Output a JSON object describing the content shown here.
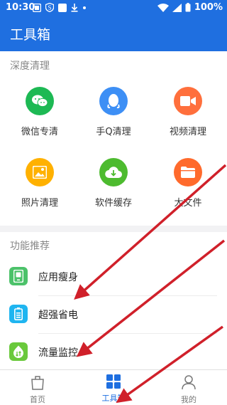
{
  "statusbar": {
    "time": "10:30",
    "battery": "100%"
  },
  "appbar": {
    "title": "工具箱"
  },
  "deep_clean": {
    "title": "深度清理",
    "items": [
      {
        "label": "微信专清",
        "icon": "wechat-icon",
        "color": "#1db954"
      },
      {
        "label": "手Q清理",
        "icon": "qq-penguin-icon",
        "color": "#3d8ff5"
      },
      {
        "label": "视频清理",
        "icon": "video-camera-icon",
        "color": "#ff6f3c"
      },
      {
        "label": "照片清理",
        "icon": "photo-icon",
        "color": "#ffb100"
      },
      {
        "label": "软件缓存",
        "icon": "cloud-download-icon",
        "color": "#4dbb2f"
      },
      {
        "label": "大文件",
        "icon": "folder-icon",
        "color": "#ff6a2c"
      }
    ]
  },
  "recommend": {
    "title": "功能推荐",
    "items": [
      {
        "label": "应用瘦身",
        "icon": "app-slim-icon",
        "color": "#4cc26a"
      },
      {
        "label": "超强省电",
        "icon": "battery-icon",
        "color": "#1fb5f0"
      },
      {
        "label": "流量监控",
        "icon": "traffic-monitor-icon",
        "color": "#6ac93c"
      }
    ]
  },
  "tabbar": {
    "tabs": [
      {
        "label": "首页",
        "active": false
      },
      {
        "label": "工具箱",
        "active": true
      },
      {
        "label": "我的",
        "active": false
      }
    ],
    "active_color": "#1f6fe0",
    "inactive_color": "#777777"
  },
  "annotation_color": "#d0202a"
}
